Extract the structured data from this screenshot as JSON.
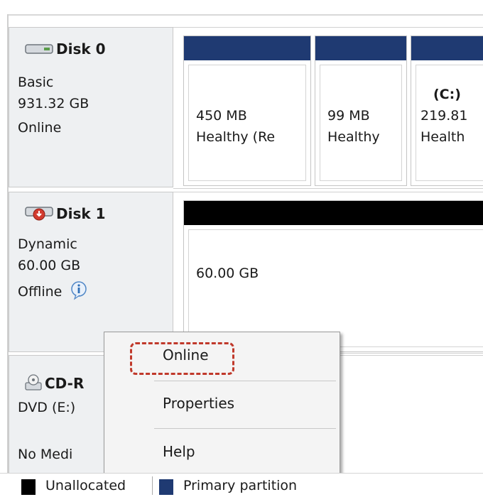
{
  "colors": {
    "primary_partition": "#1f3a72",
    "unallocated": "#000000",
    "highlight": "#c0392b"
  },
  "disks": [
    {
      "name": "Disk 0",
      "icon": "hard-disk-icon",
      "type": "Basic",
      "size": "931.32 GB",
      "status": "Online",
      "partitions": [
        {
          "title": "",
          "size": "450 MB",
          "status": "Healthy (Re"
        },
        {
          "title": "",
          "size": "99 MB",
          "status": "Healthy"
        },
        {
          "title": "(C:)",
          "size": "219.81",
          "status": "Health"
        }
      ]
    },
    {
      "name": "Disk 1",
      "icon": "offline-disk-icon",
      "type": "Dynamic",
      "size": "60.00 GB",
      "status": "Offline",
      "partitions": [
        {
          "size": "60.00 GB"
        }
      ]
    },
    {
      "name": "CD-R",
      "icon": "cd-drive-icon",
      "type": "DVD (E:)",
      "status": "No Medi"
    }
  ],
  "context_menu": {
    "items": [
      "Online",
      "Properties",
      "Help"
    ]
  },
  "legend": {
    "unallocated": "Unallocated",
    "primary": "Primary partition"
  }
}
